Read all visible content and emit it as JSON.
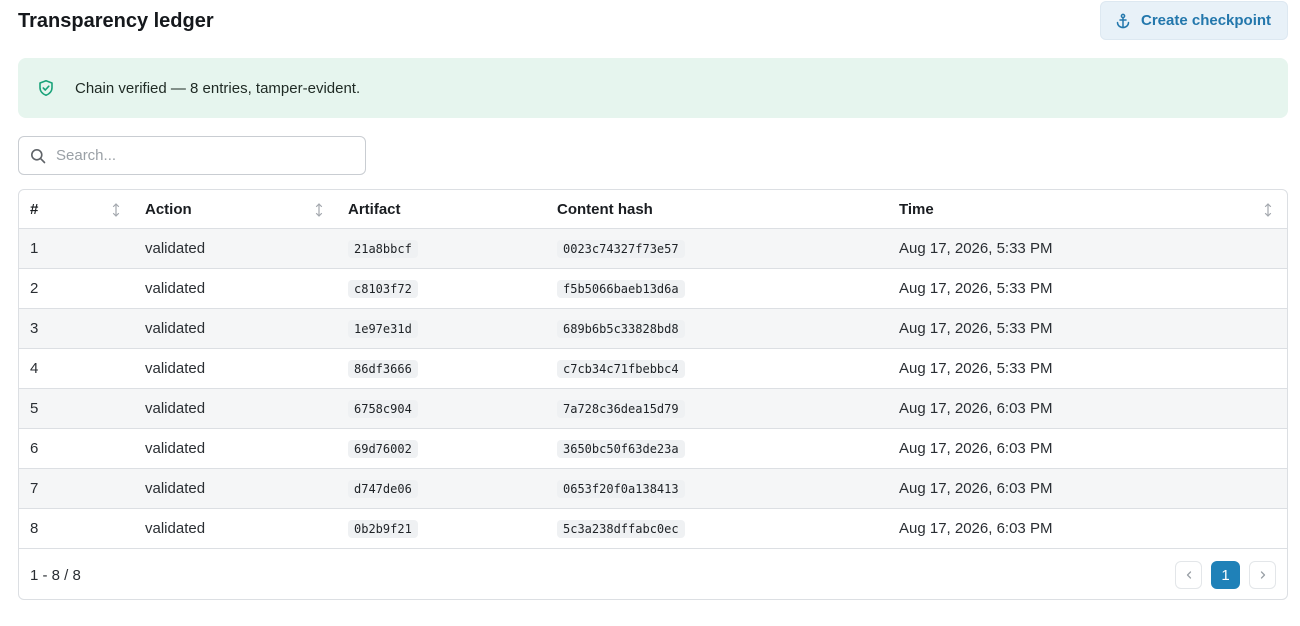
{
  "header": {
    "title": "Transparency ledger",
    "checkpoint_label": "Create checkpoint",
    "checkpoint_icon": "anchor-icon"
  },
  "alert": {
    "icon": "shield-check-icon",
    "text": "Chain verified — 8 entries, tamper-evident."
  },
  "search": {
    "placeholder": "Search...",
    "value": ""
  },
  "table": {
    "columns": [
      {
        "label": "#",
        "sortable": true
      },
      {
        "label": "Action",
        "sortable": true
      },
      {
        "label": "Artifact",
        "sortable": false
      },
      {
        "label": "Content hash",
        "sortable": false
      },
      {
        "label": "Time",
        "sortable": true
      }
    ],
    "rows": [
      {
        "num": "1",
        "action": "validated",
        "artifact": "21a8bbcf",
        "hash": "0023c74327f73e57",
        "time": "Aug 17, 2026, 5:33 PM"
      },
      {
        "num": "2",
        "action": "validated",
        "artifact": "c8103f72",
        "hash": "f5b5066baeb13d6a",
        "time": "Aug 17, 2026, 5:33 PM"
      },
      {
        "num": "3",
        "action": "validated",
        "artifact": "1e97e31d",
        "hash": "689b6b5c33828bd8",
        "time": "Aug 17, 2026, 5:33 PM"
      },
      {
        "num": "4",
        "action": "validated",
        "artifact": "86df3666",
        "hash": "c7cb34c71fbebbc4",
        "time": "Aug 17, 2026, 5:33 PM"
      },
      {
        "num": "5",
        "action": "validated",
        "artifact": "6758c904",
        "hash": "7a728c36dea15d79",
        "time": "Aug 17, 2026, 6:03 PM"
      },
      {
        "num": "6",
        "action": "validated",
        "artifact": "69d76002",
        "hash": "3650bc50f63de23a",
        "time": "Aug 17, 2026, 6:03 PM"
      },
      {
        "num": "7",
        "action": "validated",
        "artifact": "d747de06",
        "hash": "0653f20f0a138413",
        "time": "Aug 17, 2026, 6:03 PM"
      },
      {
        "num": "8",
        "action": "validated",
        "artifact": "0b2b9f21",
        "hash": "5c3a238dffabc0ec",
        "time": "Aug 17, 2026, 6:03 PM"
      }
    ]
  },
  "pagination": {
    "range": "1 - 8 / 8",
    "current_page": "1"
  },
  "colors": {
    "accent": "#1f81b8",
    "alert_bg": "#e6f5ee",
    "alert_icon": "#1aa37a",
    "button_bg": "#e8f1f8"
  }
}
